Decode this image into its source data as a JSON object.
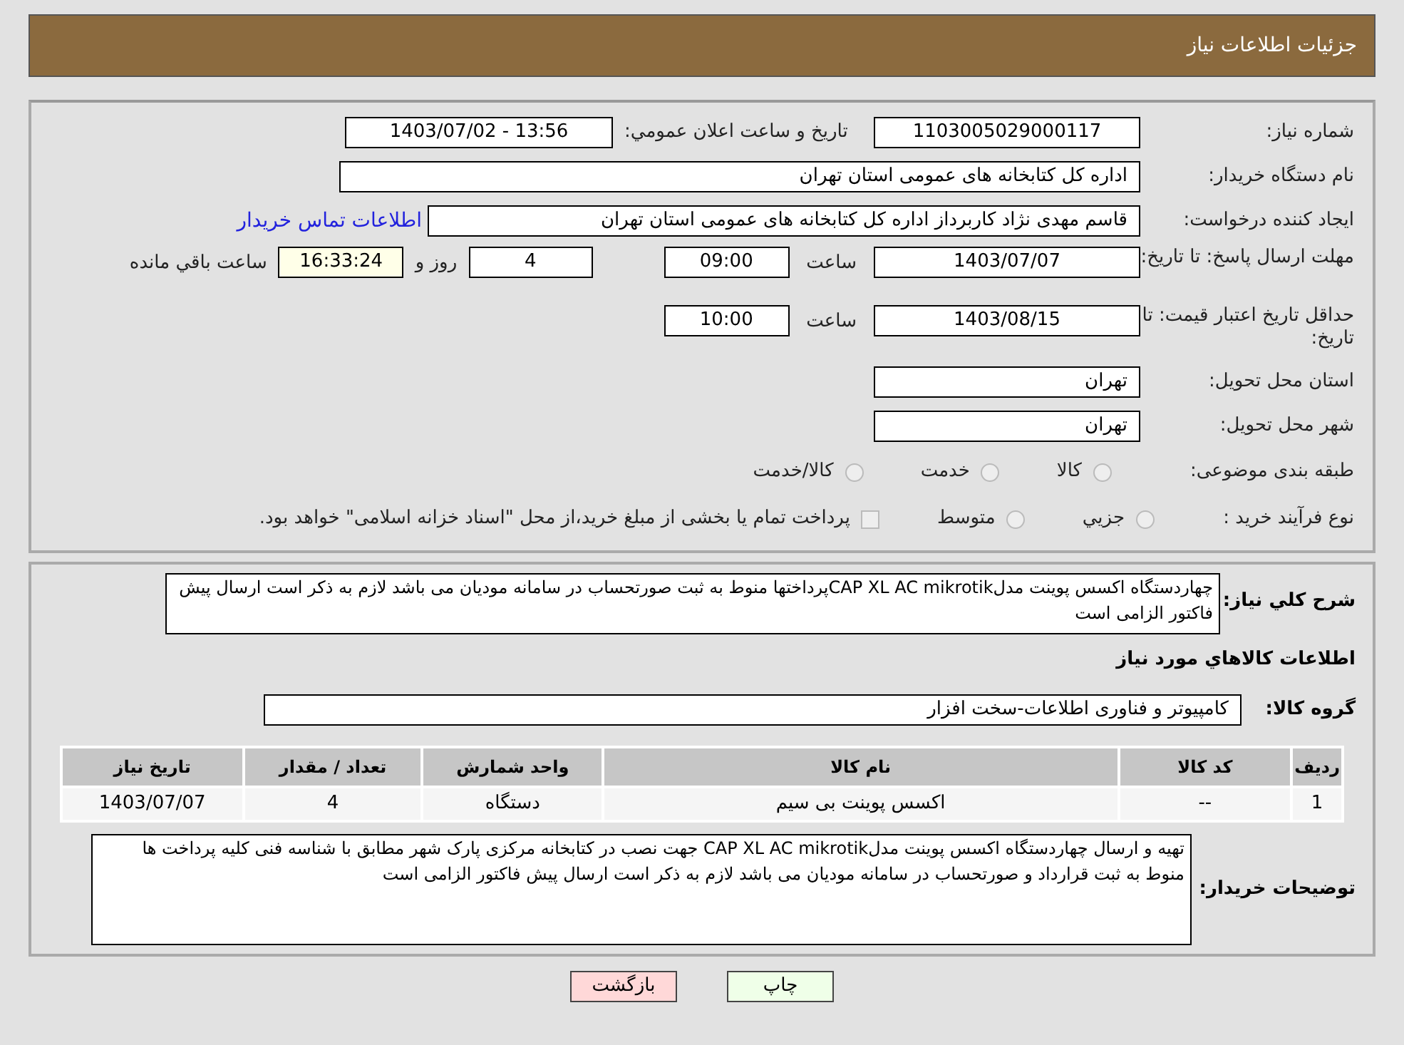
{
  "header": {
    "title": "جزئیات اطلاعات نیاز"
  },
  "info": {
    "need_number": {
      "label": "شماره نیاز:",
      "value": "1103005029000117"
    },
    "announce": {
      "label": "تاریخ و ساعت اعلان عمومي:",
      "value": "1403/07/02 - 13:56"
    },
    "buyer": {
      "label": "نام دستگاه خریدار:",
      "value": "اداره کل کتابخانه های عمومی استان تهران"
    },
    "creator": {
      "label": "ایجاد کننده درخواست:",
      "value": "قاسم مهدی نژاد کاربرداز اداره کل کتابخانه های عمومی استان تهران",
      "link": "اطلاعات تماس خریدار"
    },
    "deadline": {
      "label": "مهلت ارسال پاسخ: تا تاریخ:",
      "date": "1403/07/07",
      "time_label": "ساعت",
      "time": "09:00",
      "days": "4",
      "days_label": "روز و",
      "remaining": "16:33:24",
      "remaining_label": "ساعت باقي مانده"
    },
    "validity": {
      "label": "حداقل تاریخ اعتبار قیمت: تا تاریخ:",
      "date": "1403/08/15",
      "time_label": "ساعت",
      "time": "10:00"
    },
    "province": {
      "label": "استان محل تحویل:",
      "value": "تهران"
    },
    "city": {
      "label": "شهر محل تحویل:",
      "value": "تهران"
    },
    "category": {
      "label": "طبقه بندی موضوعی:",
      "options": [
        {
          "label": "كالا",
          "selected": false
        },
        {
          "label": "خدمت",
          "selected": false
        },
        {
          "label": "كالا/خدمت",
          "selected": false
        }
      ]
    },
    "purchase": {
      "label": "نوع فرآیند خرید :",
      "options": [
        {
          "label": "جزيي",
          "selected": false
        },
        {
          "label": "متوسط",
          "selected": false
        }
      ],
      "treasury": {
        "label": "پرداخت تمام یا بخشی از مبلغ خرید،از محل \"اسناد خزانه اسلامی\" خواهد بود.",
        "checked": false
      }
    }
  },
  "details": {
    "summary_label": "شرح کلي نیاز:",
    "summary": "چهاردستگاه اکسس پوینت مدلCAP XL AC mikrotikپرداختها منوط به ثبت صورتحساب در سامانه مودیان می باشد لازم به ذکر است ارسال پیش فاکتور الزامی است",
    "goods_title": "اطلاعات کالاهاي مورد نیاز",
    "group_label": "گروه کالا:",
    "group": "کامپیوتر و فناوری اطلاعات-سخت افزار",
    "table": {
      "columns": [
        "ردیف",
        "کد کالا",
        "نام کالا",
        "واحد شمارش",
        "تعداد / مقدار",
        "تاریخ نیاز"
      ],
      "rows": [
        [
          "1",
          "--",
          "اکسس پوینت بی سیم",
          "دستگاه",
          "4",
          "1403/07/07"
        ]
      ]
    },
    "notes_label": "توضیحات خریدار:",
    "notes": "تهیه و ارسال چهاردستگاه اکسس پوینت مدلCAP XL AC mikrotik جهت نصب در کتابخانه مرکزی پارک شهر مطابق با شناسه فنی کلیه پرداخت ها منوط به ثبت قرارداد و صورتحساب در سامانه مودیان می باشد لازم به ذکر است ارسال پیش فاکتور الزامی است"
  },
  "buttons": [
    {
      "kind": "print",
      "label": "چاپ"
    },
    {
      "kind": "back",
      "label": "بازگشت"
    }
  ]
}
